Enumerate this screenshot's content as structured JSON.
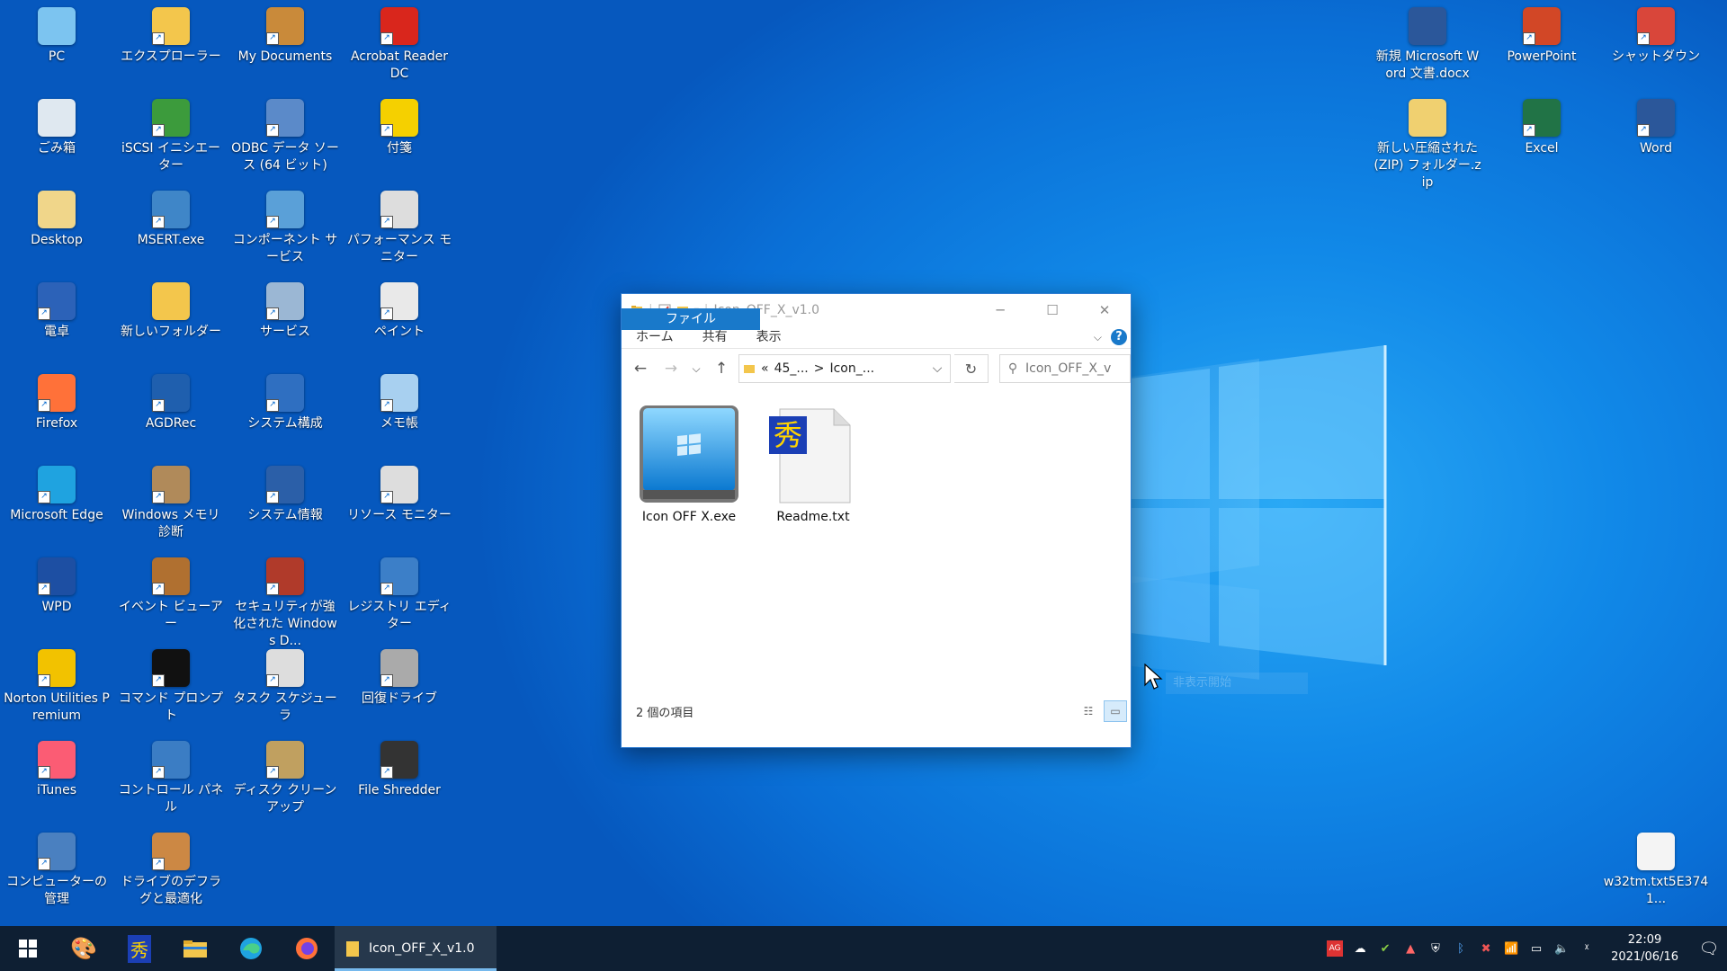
{
  "desktop": {
    "icons": [
      {
        "label": "PC",
        "icon": "pc-icon"
      },
      {
        "label": "エクスプローラー",
        "icon": "folder-icon"
      },
      {
        "label": "My Documents",
        "icon": "documents-icon"
      },
      {
        "label": "Acrobat Reader DC",
        "icon": "acrobat-icon"
      },
      {
        "label": "ごみ箱",
        "icon": "recycle-bin-icon"
      },
      {
        "label": "iSCSI イニシエーター",
        "icon": "iscsi-icon"
      },
      {
        "label": "ODBC データ ソース (64 ビット)",
        "icon": "odbc-icon"
      },
      {
        "label": "付箋",
        "icon": "sticky-notes-icon"
      },
      {
        "label": "Desktop",
        "icon": "desktop-folder-icon"
      },
      {
        "label": "MSERT.exe",
        "icon": "msert-icon"
      },
      {
        "label": "コンポーネント サービス",
        "icon": "component-services-icon"
      },
      {
        "label": "パフォーマンス モニター",
        "icon": "performance-monitor-icon"
      },
      {
        "label": "電卓",
        "icon": "calculator-icon"
      },
      {
        "label": "新しいフォルダー",
        "icon": "new-folder-icon"
      },
      {
        "label": "サービス",
        "icon": "services-icon"
      },
      {
        "label": "ペイント",
        "icon": "paint-icon"
      },
      {
        "label": "Firefox",
        "icon": "firefox-icon"
      },
      {
        "label": "AGDRec",
        "icon": "agdrec-icon"
      },
      {
        "label": "システム構成",
        "icon": "system-config-icon"
      },
      {
        "label": "メモ帳",
        "icon": "notepad-icon"
      },
      {
        "label": "Microsoft Edge",
        "icon": "edge-icon"
      },
      {
        "label": "Windows メモリ診断",
        "icon": "memory-diagnostic-icon"
      },
      {
        "label": "システム情報",
        "icon": "system-info-icon"
      },
      {
        "label": "リソース モニター",
        "icon": "resource-monitor-icon"
      },
      {
        "label": "WPD",
        "icon": "wpd-icon"
      },
      {
        "label": "イベント ビューアー",
        "icon": "event-viewer-icon"
      },
      {
        "label": "セキュリティが強化された Windows D...",
        "icon": "firewall-icon"
      },
      {
        "label": "レジストリ エディター",
        "icon": "registry-editor-icon"
      },
      {
        "label": "Norton Utilities Premium",
        "icon": "norton-icon"
      },
      {
        "label": "コマンド プロンプト",
        "icon": "command-prompt-icon"
      },
      {
        "label": "タスク スケジューラ",
        "icon": "task-scheduler-icon"
      },
      {
        "label": "回復ドライブ",
        "icon": "recovery-drive-icon"
      },
      {
        "label": "iTunes",
        "icon": "itunes-icon"
      },
      {
        "label": "コントロール パネル",
        "icon": "control-panel-icon"
      },
      {
        "label": "ディスク クリーンアップ",
        "icon": "disk-cleanup-icon"
      },
      {
        "label": "File Shredder",
        "icon": "file-shredder-icon"
      },
      {
        "label": "コンピューターの管理",
        "icon": "computer-management-icon"
      },
      {
        "label": "ドライブのデフラグと最適化",
        "icon": "defrag-icon"
      }
    ],
    "right_icons": [
      {
        "label": "新規 Microsoft Word 文書.docx",
        "icon": "word-doc-icon"
      },
      {
        "label": "PowerPoint",
        "icon": "powerpoint-icon"
      },
      {
        "label": "シャットダウン",
        "icon": "shutdown-icon"
      },
      {
        "label": "新しい圧縮された (ZIP) フォルダー.zip",
        "icon": "zip-folder-icon"
      },
      {
        "label": "Excel",
        "icon": "excel-icon"
      },
      {
        "label": "Word",
        "icon": "word-icon"
      },
      {
        "label": "w32tm.txt5E3741...",
        "icon": "text-file-icon"
      }
    ]
  },
  "explorer": {
    "title": "Icon_OFF_X_v1.0",
    "ribbon_tabs": [
      "ファイル",
      "ホーム",
      "共有",
      "表示"
    ],
    "address": {
      "prefix": "«",
      "seg1": "45_...",
      "sep": ">",
      "seg2": "Icon_..."
    },
    "search_placeholder": "Icon_OFF_X_v",
    "files": [
      {
        "name": "Icon OFF X.exe",
        "icon": "windows-exe-icon"
      },
      {
        "name": "Readme.txt",
        "icon": "hidemaru-text-icon"
      }
    ],
    "status": "2 個の項目"
  },
  "ghost_tooltip": "非表示開始",
  "taskbar": {
    "active_window": "Icon_OFF_X_v1.0",
    "time": "22:09",
    "date": "2021/06/16"
  }
}
